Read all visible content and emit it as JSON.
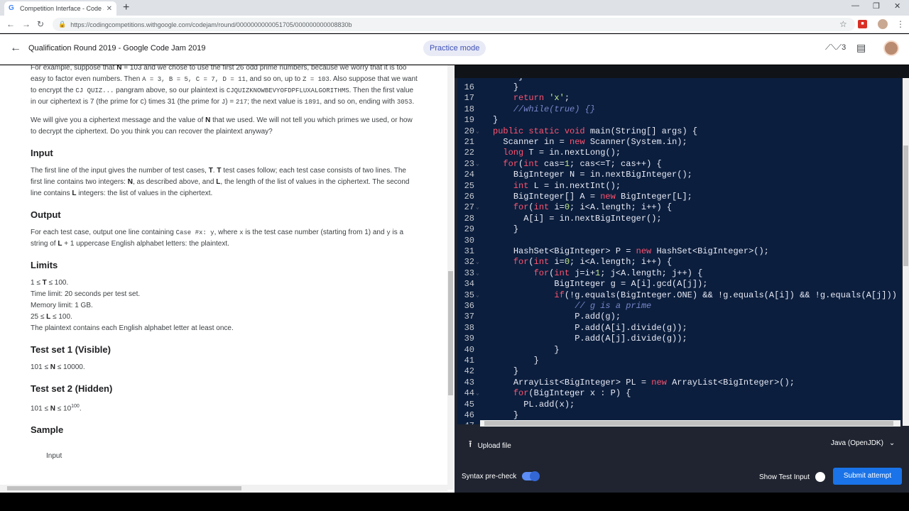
{
  "browser": {
    "tab_title": "Competition Interface - Code Jam",
    "favicon": "G",
    "url": "https://codingcompetitions.withgoogle.com/codejam/round/0000000000051705/000000000008830b"
  },
  "header": {
    "title": "Qualification Round 2019 - Google Code Jam 2019",
    "practice_label": "Practice mode",
    "rank_badge": "3"
  },
  "problem": {
    "p1_a": "For example, suppose that ",
    "p1_b": "N",
    "p1_c": " = 103 and we chose to use the first 26 odd prime numbers, because we worry that it is too easy to factor even numbers. Then ",
    "p1_d": "A = 3, B = 5, C = 7, D = 11",
    "p1_e": ", and so on, up to ",
    "p1_f": "Z = 103",
    "p1_g": ". Also suppose that we want to encrypt the ",
    "p1_h": "CJ QUIZ...",
    "p1_i": " pangram above, so our plaintext is ",
    "p1_j": "CJQUIZKNOWBEVYOFDPFLUXALGORITHMS",
    "p1_k": ". Then the first value in our ciphertext is 7 (the prime for ",
    "p1_l": "C",
    "p1_m": ") times 31 (the prime for ",
    "p1_n": "J",
    "p1_o": ") = ",
    "p1_p": "217",
    "p1_q": "; the next value is ",
    "p1_r": "1891",
    "p1_s": ", and so on, ending with ",
    "p1_t": "3053",
    "p1_u": ".",
    "p2_a": "We will give you a ciphertext message and the value of ",
    "p2_b": "N",
    "p2_c": " that we used. We will not tell you which primes we used, or how to decrypt the ciphertext. Do you think you can recover the plaintext anyway?",
    "input_heading": "Input",
    "input_a": "The first line of the input gives the number of test cases, ",
    "input_b": "T",
    "input_c": ". ",
    "input_d": "T",
    "input_e": " test cases follow; each test case consists of two lines. The first line contains two integers: ",
    "input_f": "N",
    "input_g": ", as described above, and ",
    "input_h": "L",
    "input_i": ", the length of the list of values in the ciphertext. The second line contains ",
    "input_j": "L",
    "input_k": " integers: the list of values in the ciphertext.",
    "output_heading": "Output",
    "output_a": "For each test case, output one line containing ",
    "output_b": "Case #x: y",
    "output_c": ", where ",
    "output_d": "x",
    "output_e": " is the test case number (starting from 1) and ",
    "output_f": "y",
    "output_g": " is a string of ",
    "output_h": "L",
    "output_i": " + 1 uppercase English alphabet letters: the plaintext.",
    "limits_heading": "Limits",
    "lim1_a": "1 ≤ ",
    "lim1_b": "T",
    "lim1_c": " ≤ 100.",
    "lim2": "Time limit: 20 seconds per test set.",
    "lim3": "Memory limit: 1 GB.",
    "lim4_a": "25 ≤ ",
    "lim4_b": "L",
    "lim4_c": " ≤ 100.",
    "lim5": "The plaintext contains each English alphabet letter at least once.",
    "ts1_heading": "Test set 1 (Visible)",
    "ts1_a": "101 ≤ ",
    "ts1_b": "N",
    "ts1_c": " ≤ 10000.",
    "ts2_heading": "Test set 2 (Hidden)",
    "ts2_a": "101 ≤ ",
    "ts2_b": "N",
    "ts2_c": " ≤ 10",
    "ts2_sup": "100",
    "ts2_d": ".",
    "sample_heading": "Sample",
    "sample_input_label": "Input"
  },
  "editor": {
    "top_partial": "}",
    "lines": [
      {
        "n": "16",
        "fold": false,
        "indent": "    ",
        "parts": [
          [
            "p",
            "}"
          ]
        ]
      },
      {
        "n": "17",
        "fold": false,
        "indent": "    ",
        "parts": [
          [
            "k",
            "return "
          ],
          [
            "s",
            "'x'"
          ],
          [
            "p",
            ";"
          ]
        ]
      },
      {
        "n": "18",
        "fold": false,
        "indent": "    ",
        "parts": [
          [
            "c",
            "//while(true) {}"
          ]
        ]
      },
      {
        "n": "19",
        "fold": false,
        "indent": "",
        "parts": [
          [
            "p",
            "}"
          ]
        ]
      },
      {
        "n": "20",
        "fold": true,
        "indent": "",
        "parts": [
          [
            "k",
            "public static void "
          ],
          [
            "p",
            "main(String[] args) {"
          ]
        ]
      },
      {
        "n": "21",
        "fold": false,
        "indent": "  ",
        "parts": [
          [
            "p",
            "Scanner in = "
          ],
          [
            "k",
            "new "
          ],
          [
            "p",
            "Scanner(System.in);"
          ]
        ]
      },
      {
        "n": "22",
        "fold": false,
        "indent": "  ",
        "parts": [
          [
            "k",
            "long "
          ],
          [
            "p",
            "T = in.nextLong();"
          ]
        ]
      },
      {
        "n": "23",
        "fold": true,
        "indent": "  ",
        "parts": [
          [
            "k",
            "for"
          ],
          [
            "p",
            "("
          ],
          [
            "k",
            "int "
          ],
          [
            "p",
            "cas="
          ],
          [
            "s",
            "1"
          ],
          [
            "p",
            "; cas<=T; cas++) {"
          ]
        ]
      },
      {
        "n": "24",
        "fold": false,
        "indent": "    ",
        "parts": [
          [
            "p",
            "BigInteger N = in.nextBigInteger();"
          ]
        ]
      },
      {
        "n": "25",
        "fold": false,
        "indent": "    ",
        "parts": [
          [
            "k",
            "int "
          ],
          [
            "p",
            "L = in.nextInt();"
          ]
        ]
      },
      {
        "n": "26",
        "fold": false,
        "indent": "    ",
        "parts": [
          [
            "p",
            "BigInteger[] A = "
          ],
          [
            "k",
            "new "
          ],
          [
            "p",
            "BigInteger[L];"
          ]
        ]
      },
      {
        "n": "27",
        "fold": true,
        "indent": "    ",
        "parts": [
          [
            "k",
            "for"
          ],
          [
            "p",
            "("
          ],
          [
            "k",
            "int "
          ],
          [
            "p",
            "i="
          ],
          [
            "s",
            "0"
          ],
          [
            "p",
            "; i<A.length; i++) {"
          ]
        ]
      },
      {
        "n": "28",
        "fold": false,
        "indent": "      ",
        "parts": [
          [
            "p",
            "A[i] = in.nextBigInteger();"
          ]
        ]
      },
      {
        "n": "29",
        "fold": false,
        "indent": "    ",
        "parts": [
          [
            "p",
            "}"
          ]
        ]
      },
      {
        "n": "30",
        "fold": false,
        "indent": "",
        "parts": []
      },
      {
        "n": "31",
        "fold": false,
        "indent": "    ",
        "parts": [
          [
            "p",
            "HashSet<BigInteger> P = "
          ],
          [
            "k",
            "new "
          ],
          [
            "p",
            "HashSet<BigInteger>();"
          ]
        ]
      },
      {
        "n": "32",
        "fold": true,
        "indent": "    ",
        "parts": [
          [
            "k",
            "for"
          ],
          [
            "p",
            "("
          ],
          [
            "k",
            "int "
          ],
          [
            "p",
            "i="
          ],
          [
            "s",
            "0"
          ],
          [
            "p",
            "; i<A.length; i++) {"
          ]
        ]
      },
      {
        "n": "33",
        "fold": true,
        "indent": "        ",
        "parts": [
          [
            "k",
            "for"
          ],
          [
            "p",
            "("
          ],
          [
            "k",
            "int "
          ],
          [
            "p",
            "j=i+"
          ],
          [
            "s",
            "1"
          ],
          [
            "p",
            "; j<A.length; j++) {"
          ]
        ]
      },
      {
        "n": "34",
        "fold": false,
        "indent": "            ",
        "parts": [
          [
            "p",
            "BigInteger g = A[i].gcd(A[j]);"
          ]
        ]
      },
      {
        "n": "35",
        "fold": true,
        "indent": "            ",
        "parts": [
          [
            "k",
            "if"
          ],
          [
            "p",
            "(!g.equals(BigInteger.ONE) && !g.equals(A[i]) && !g.equals(A[j]))"
          ]
        ]
      },
      {
        "n": "36",
        "fold": false,
        "indent": "                ",
        "parts": [
          [
            "c",
            "// g is a prime"
          ]
        ]
      },
      {
        "n": "37",
        "fold": false,
        "indent": "                ",
        "parts": [
          [
            "p",
            "P.add(g);"
          ]
        ]
      },
      {
        "n": "38",
        "fold": false,
        "indent": "                ",
        "parts": [
          [
            "p",
            "P.add(A[i].divide(g));"
          ]
        ]
      },
      {
        "n": "39",
        "fold": false,
        "indent": "                ",
        "parts": [
          [
            "p",
            "P.add(A[j].divide(g));"
          ]
        ]
      },
      {
        "n": "40",
        "fold": false,
        "indent": "            ",
        "parts": [
          [
            "p",
            "}"
          ]
        ]
      },
      {
        "n": "41",
        "fold": false,
        "indent": "        ",
        "parts": [
          [
            "p",
            "}"
          ]
        ]
      },
      {
        "n": "42",
        "fold": false,
        "indent": "    ",
        "parts": [
          [
            "p",
            "}"
          ]
        ]
      },
      {
        "n": "43",
        "fold": false,
        "indent": "    ",
        "parts": [
          [
            "p",
            "ArrayList<BigInteger> PL = "
          ],
          [
            "k",
            "new "
          ],
          [
            "p",
            "ArrayList<BigInteger>();"
          ]
        ]
      },
      {
        "n": "44",
        "fold": true,
        "indent": "    ",
        "parts": [
          [
            "k",
            "for"
          ],
          [
            "p",
            "(BigInteger x : P) {"
          ]
        ]
      },
      {
        "n": "45",
        "fold": false,
        "indent": "      ",
        "parts": [
          [
            "p",
            "PL.add(x);"
          ]
        ]
      },
      {
        "n": "46",
        "fold": false,
        "indent": "    ",
        "parts": [
          [
            "p",
            "}"
          ]
        ]
      },
      {
        "n": "47",
        "fold": false,
        "indent": "",
        "parts": []
      }
    ]
  },
  "footer": {
    "upload_label": "Upload file",
    "language": "Java (OpenJDK)",
    "precheck_label": "Syntax pre-check",
    "show_test_label": "Show Test Input",
    "submit_label": "Submit attempt"
  },
  "colors": {
    "accent": "#1a73e8",
    "editor_bg": "#0b1e3d",
    "keyword": "#ff5370",
    "string": "#c3e88d",
    "comment": "#7986cb"
  },
  "icons": [
    "back-arrow-icon",
    "forward-arrow-icon",
    "reload-icon",
    "lock-icon",
    "star-icon",
    "trend-icon",
    "chat-icon",
    "upload-icon",
    "chevron-down-icon",
    "close-icon"
  ]
}
